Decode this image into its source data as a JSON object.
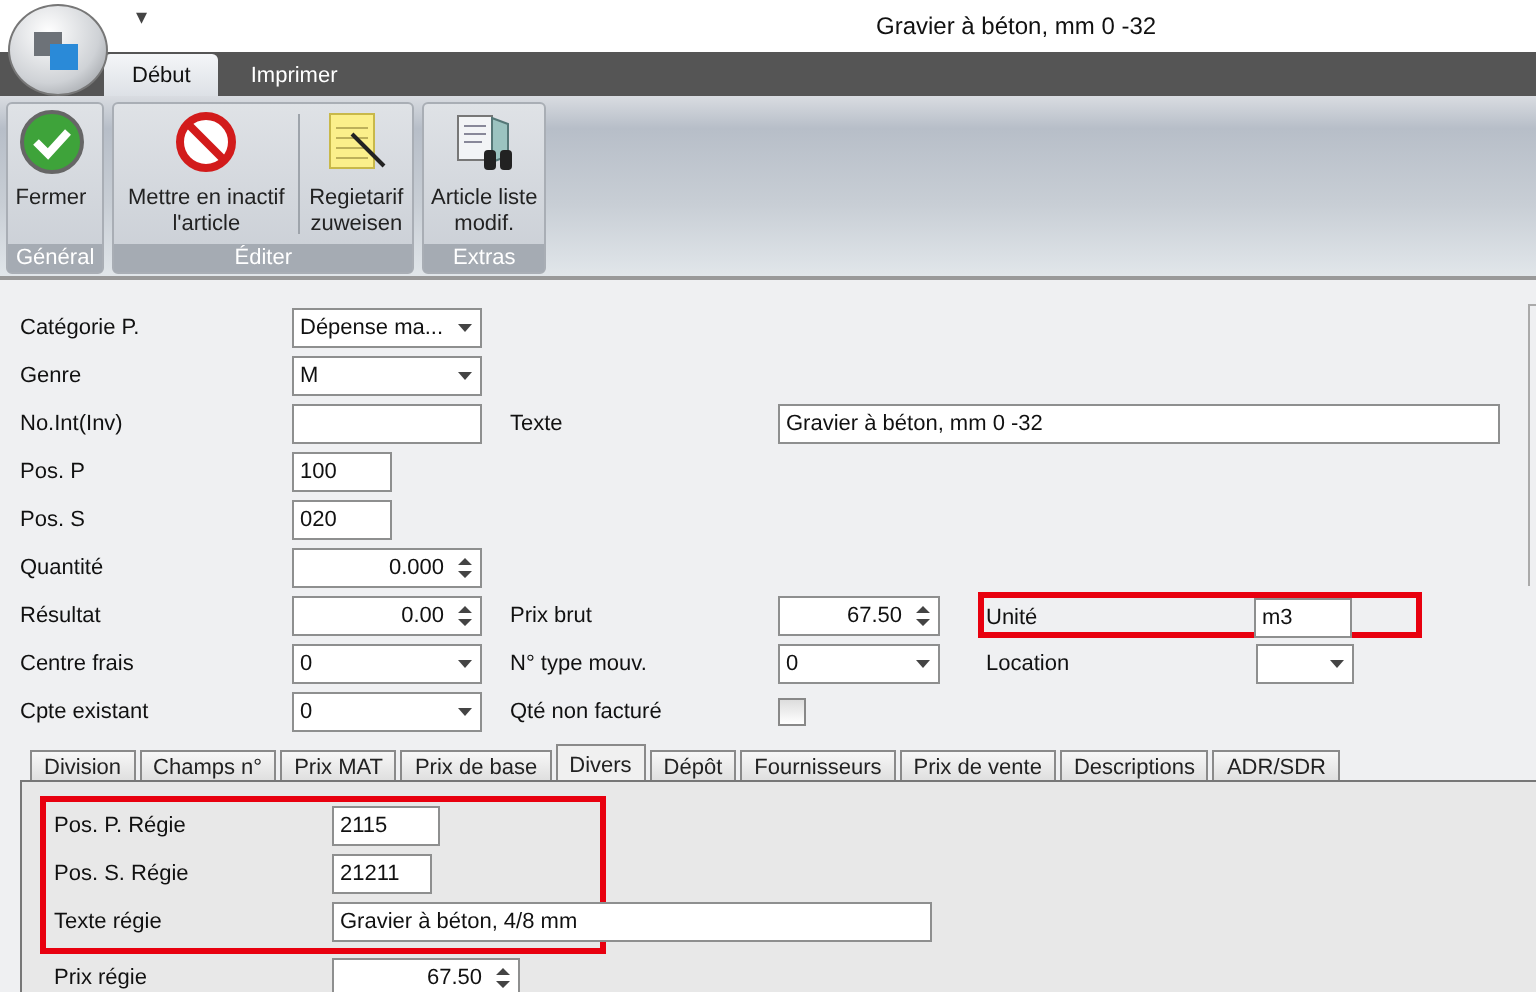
{
  "window": {
    "title": "Gravier à béton, mm 0 -32",
    "quick_access": "▾"
  },
  "ribbon": {
    "tabs": [
      {
        "label": "Début",
        "selected": true
      },
      {
        "label": "Imprimer",
        "selected": false
      }
    ],
    "groups": [
      {
        "label": "Général",
        "buttons": [
          {
            "label": "Fermer",
            "kind": "check"
          }
        ]
      },
      {
        "label": "Éditer",
        "buttons": [
          {
            "label": "Mettre en inactif l'article",
            "kind": "forbid"
          },
          {
            "label": "Regietarif zuweisen",
            "kind": "notepad"
          }
        ]
      },
      {
        "label": "Extras",
        "buttons": [
          {
            "label": "Article liste modif.",
            "kind": "binoculars"
          }
        ]
      }
    ]
  },
  "form": {
    "rows": [
      {
        "fields": [
          {
            "label": "Catégorie P.",
            "kind": "dropdown",
            "value": "Dépense ma..."
          }
        ]
      },
      {
        "fields": [
          {
            "label": "Genre",
            "kind": "dropdown",
            "value": "M"
          }
        ]
      },
      {
        "fields": [
          {
            "label": "No.Int(Inv)",
            "kind": "text"
          },
          {
            "label": "Texte",
            "kind": "text",
            "value": "Gravier à béton, mm 0 -32"
          }
        ]
      },
      {
        "fields": [
          {
            "label": "Pos. P",
            "kind": "text",
            "value": "100"
          }
        ]
      },
      {
        "fields": [
          {
            "label": "Pos. S",
            "kind": "text",
            "value": "020"
          }
        ]
      },
      {
        "fields": [
          {
            "label": "Quantité",
            "kind": "spin",
            "value": "0.000"
          }
        ]
      },
      {
        "fields": [
          {
            "label": "Résultat",
            "kind": "spin",
            "value": "0.00"
          },
          {
            "label": "Prix brut",
            "kind": "spin",
            "value": "67.50"
          },
          {
            "label": "Unité",
            "kind": "text",
            "value": "m3",
            "highlighted": true
          }
        ]
      },
      {
        "fields": [
          {
            "label": "Centre frais",
            "kind": "dropdown",
            "value": "0"
          },
          {
            "label": "N° type mouv.",
            "kind": "dropdown",
            "value": "0"
          },
          {
            "label": "Location",
            "kind": "dropdown"
          }
        ]
      },
      {
        "fields": [
          {
            "label": "Cpte existant",
            "kind": "dropdown",
            "value": "0"
          },
          {
            "label": "Qté non facturé",
            "kind": "checkbox",
            "checked": false
          }
        ]
      }
    ]
  },
  "tabs": [
    {
      "label": "Division",
      "selected": false
    },
    {
      "label": "Champs n°",
      "selected": false
    },
    {
      "label": "Prix MAT",
      "selected": false
    },
    {
      "label": "Prix de base",
      "selected": false
    },
    {
      "label": "Divers",
      "selected": true
    },
    {
      "label": "Dépôt",
      "selected": false
    },
    {
      "label": "Fournisseurs",
      "selected": false
    },
    {
      "label": "Prix de vente",
      "selected": false
    },
    {
      "label": "Descriptions",
      "selected": false
    },
    {
      "label": "ADR/SDR",
      "selected": false
    }
  ],
  "divers": {
    "fields": [
      {
        "label": "Pos. P. Régie",
        "kind": "text",
        "value": "2115",
        "highlighted": true
      },
      {
        "label": "Pos. S. Régie",
        "kind": "text",
        "value": "21211",
        "highlighted": true
      },
      {
        "label": "Texte régie",
        "kind": "text",
        "value": "Gravier à béton, 4/8 mm",
        "highlighted": true
      },
      {
        "label": "Prix régie",
        "kind": "spin",
        "value": "67.50",
        "highlighted": false
      }
    ]
  }
}
